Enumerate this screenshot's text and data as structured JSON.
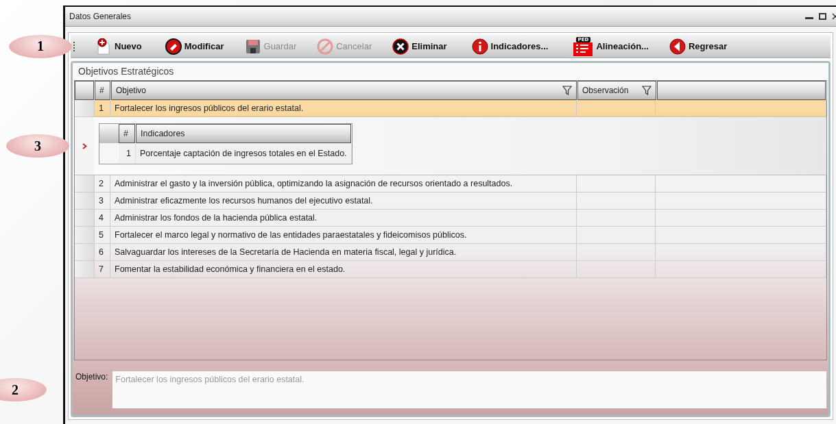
{
  "window": {
    "title": "Datos Generales"
  },
  "toolbar": {
    "callout": "1",
    "buttons": [
      {
        "kind": "new",
        "label": "Nuevo",
        "disabled": false
      },
      {
        "kind": "edit",
        "label": "Modificar",
        "disabled": false
      },
      {
        "kind": "save",
        "label": "Guardar",
        "disabled": true
      },
      {
        "kind": "cancel",
        "label": "Cancelar",
        "disabled": true
      },
      {
        "kind": "delete",
        "label": "Eliminar",
        "disabled": false
      },
      {
        "kind": "info",
        "label": "Indicadores...",
        "disabled": false
      },
      {
        "kind": "plan",
        "label": "Alineación...",
        "badge": "PED",
        "disabled": false
      },
      {
        "kind": "back",
        "label": "Regresar",
        "disabled": false
      }
    ]
  },
  "panel": {
    "title": "Objetivos Estratégicos"
  },
  "grid": {
    "columns": [
      {
        "label": "#",
        "filter": false
      },
      {
        "label": "Objetivo",
        "filter": true
      },
      {
        "label": "Observación",
        "filter": true
      }
    ],
    "rows": [
      {
        "number": "1",
        "objetivo": "Fortalecer los ingresos públicos del erario estatal.",
        "selected": true,
        "detail": {
          "callout": "3",
          "columns": [
            "#",
            "Indicadores"
          ],
          "rows": [
            {
              "number": "1",
              "indicador": "Porcentaje captación de ingresos totales en el Estado."
            }
          ]
        }
      },
      {
        "number": "2",
        "objetivo": "Administrar el gasto y la inversión pública, optimizando la asignación de recursos orientado a resultados.",
        "selected": false
      },
      {
        "number": "3",
        "objetivo": "Administrar eficazmente los recursos humanos del ejecutivo estatal.",
        "selected": false
      },
      {
        "number": "4",
        "objetivo": "Administrar los fondos de la hacienda pública estatal.",
        "selected": false
      },
      {
        "number": "5",
        "objetivo": "Fortalecer el marco legal y normativo de las entidades paraestatales y fideicomisos públicos.",
        "selected": false
      },
      {
        "number": "6",
        "objetivo": "Salvaguardar los intereses de la Secretaría de Hacienda en materia fiscal, legal y jurídica.",
        "selected": false
      },
      {
        "number": "7",
        "objetivo": "Fomentar la estabilidad económica y financiera en el estado.",
        "selected": false
      }
    ]
  },
  "field": {
    "callout": "2",
    "label": "Objetivo:",
    "value": "Fortalecer los ingresos públicos del erario estatal.",
    "readonly": true
  }
}
